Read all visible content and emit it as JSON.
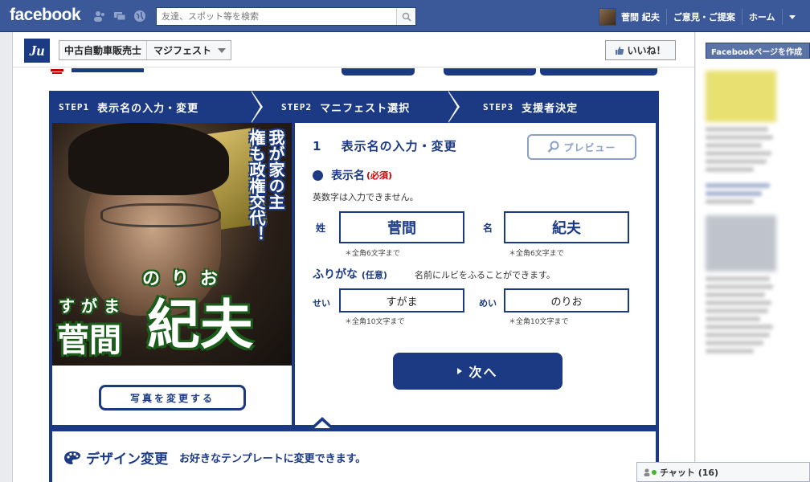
{
  "topbar": {
    "logo": "facebook",
    "search_placeholder": "友達、スポット等を検索",
    "user_name": "菅間 紀夫",
    "feedback": "ご意見・ご提案",
    "home": "ホーム"
  },
  "app_header": {
    "logo_text": "Ju",
    "page_name": "中古自動車販売士",
    "app_name": "マジフェスト",
    "like_label": "いいね！"
  },
  "steps": [
    {
      "num": "STEP1",
      "label": "表示名の入力・変更"
    },
    {
      "num": "STEP2",
      "label": "マニフェスト選択"
    },
    {
      "num": "STEP3",
      "label": "支援者決定"
    }
  ],
  "poster": {
    "slogan_col1": "我が家の主",
    "slogan_col2": "権も政権交代！",
    "ruby_given": "のりお",
    "ruby_family": "すがま",
    "family": "菅間",
    "given": "紀夫",
    "change_photo": "写真を変更する"
  },
  "form": {
    "section_num": "1",
    "section_title": "表示名の入力・変更",
    "preview": "プレビュー",
    "display_name_label": "表示名",
    "required": "(必須)",
    "alnum_note": "英数字は入力できません。",
    "sei_label": "姓",
    "mei_label": "名",
    "sei_value": "菅間",
    "mei_value": "紀夫",
    "name_hint": "＊全角6文字まで",
    "furigana_label": "ふりがな",
    "optional": "(任意)",
    "furigana_note": "名前にルビをふることができます。",
    "sei_kana_label": "せい",
    "mei_kana_label": "めい",
    "sei_kana_value": "すがま",
    "mei_kana_value": "のりお",
    "kana_hint": "＊全角10文字まで",
    "next": "次へ"
  },
  "design": {
    "title": "デザイン変更",
    "note": "お好きなテンプレートに変更できます。"
  },
  "sidebar": {
    "page_button": "Facebookページを作成",
    "chat": "チャット (16)"
  },
  "colors": {
    "fb_blue": "#3b5998",
    "app_navy": "#1b3a83",
    "required_red": "#cc0000"
  }
}
